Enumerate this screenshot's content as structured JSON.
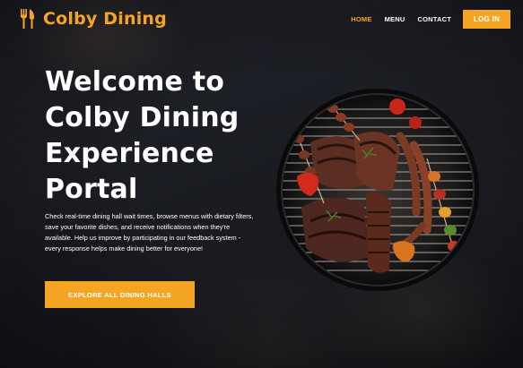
{
  "brand": {
    "name": "Colby Dining",
    "icon": "fork-knife-icon",
    "color": "#f5a524"
  },
  "nav": {
    "items": [
      {
        "label": "HOME",
        "active": true
      },
      {
        "label": "MENU",
        "active": false
      },
      {
        "label": "CONTACT",
        "active": false
      }
    ],
    "login_label": "LOG IN"
  },
  "hero": {
    "title": "Welcome to Colby Dining Experience Portal",
    "description": "Check real-time dining hall wait times, browse menus with dietary filters, save your favorite dishes, and receive notifications when they're available. Help us improve by participating in our feedback system - every response helps make dining better for everyone!",
    "cta_label": "EXPLORE ALL DINING HALLS",
    "image": "grill-with-meat-and-vegetables"
  },
  "colors": {
    "accent": "#f5a524",
    "background": "#1b1d24",
    "text": "#ffffff"
  }
}
